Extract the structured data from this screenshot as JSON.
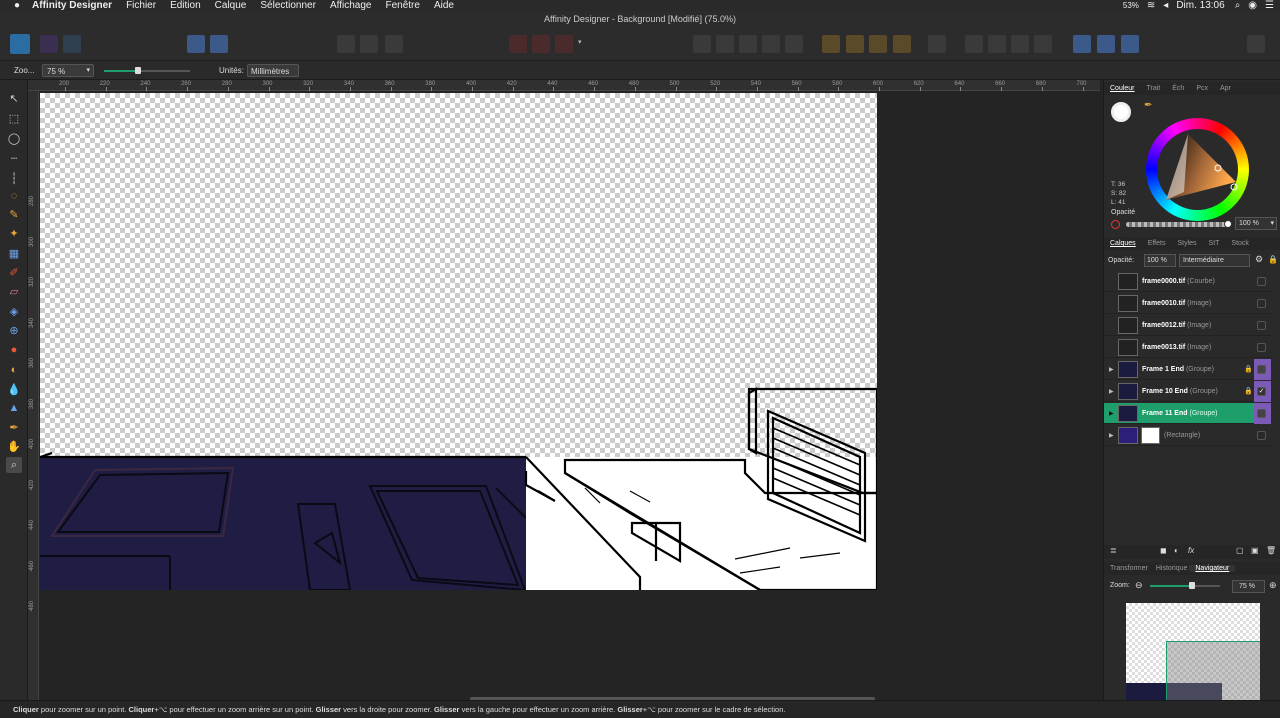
{
  "menubar": {
    "apple": "",
    "app": "Affinity Designer",
    "items": [
      "Fichier",
      "Edition",
      "Calque",
      "Sélectionner",
      "Affichage",
      "Fenêtre",
      "Aide"
    ],
    "battery": "53%",
    "clock": "Dim. 13:06"
  },
  "window": {
    "title": "Affinity Designer - Background [Modifié] (75.0%)"
  },
  "context": {
    "zoom_label": "Zoo...",
    "zoom_value": "75 %",
    "zoom_fraction": 0.4,
    "units_label": "Unités:",
    "units_value": "Millimètres"
  },
  "rulers": {
    "h": [
      "200",
      "220",
      "240",
      "260",
      "280",
      "300",
      "320",
      "340",
      "360",
      "380",
      "400",
      "420",
      "440",
      "460",
      "480",
      "500",
      "520",
      "540",
      "560",
      "580",
      "600",
      "620",
      "640",
      "660",
      "680",
      "700"
    ],
    "v": [
      "280",
      "300",
      "320",
      "340",
      "360",
      "380",
      "400",
      "420",
      "440",
      "460",
      "480"
    ]
  },
  "color_panel": {
    "tabs": [
      "Couleur",
      "Trait",
      "Éch",
      "Pcx",
      "Apr"
    ],
    "t": "T: 36",
    "s": "S: 82",
    "l": "L: 41",
    "opacity_label": "Opacité",
    "opacity_value": "100 %"
  },
  "layers_panel": {
    "tabs": [
      "Calques",
      "Effets",
      "Styles",
      "StT",
      "Stock"
    ],
    "opacity_label": "Opacité:",
    "opacity_value": "100 %",
    "blend": "Intermédiaire",
    "layers": [
      {
        "name": "frame0000.tif",
        "type": "(Courbe)"
      },
      {
        "name": "frame0010.tif",
        "type": "(Image)"
      },
      {
        "name": "frame0012.tif",
        "type": "(Image)"
      },
      {
        "name": "frame0013.tif",
        "type": "(Image)"
      },
      {
        "name": "Frame 1 End",
        "type": "(Groupe)"
      },
      {
        "name": "Frame 10 End",
        "type": "(Groupe)"
      },
      {
        "name": "Frame 11 End",
        "type": "(Groupe)"
      },
      {
        "name": "",
        "type": "(Rectangle)"
      }
    ]
  },
  "nav_panel": {
    "tabs": [
      "Transformer",
      "Historique",
      "Navigateur"
    ],
    "zoom_label": "Zoom:",
    "zoom_value": "75 %",
    "zoom_fraction": 0.6
  },
  "status": {
    "parts": [
      {
        "b": "Cliquer",
        "t": " pour zoomer sur un point. "
      },
      {
        "b": "Cliquer",
        "t": "+⌥ pour effectuer un zoom arrière sur un point. "
      },
      {
        "b": "Glisser",
        "t": " vers la droite pour zoomer. "
      },
      {
        "b": "Glisser",
        "t": " vers la gauche pour effectuer un zoom arrière. "
      },
      {
        "b": "Glisser",
        "t": "+⌥ pour zoomer sur le cadre de sélection."
      }
    ]
  },
  "colors": {
    "accent": "#1e9e6b",
    "lock_purple": "#7b5bb6",
    "doc_dark": "#1b1a3f"
  }
}
